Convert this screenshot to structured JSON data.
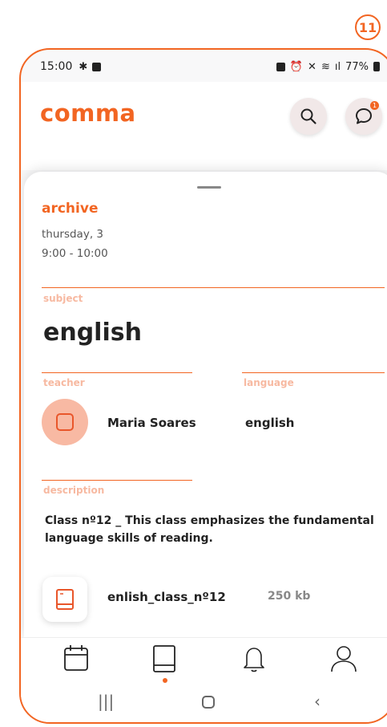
{
  "step_badge": "11",
  "status_bar": {
    "time": "15:00",
    "battery": "77%"
  },
  "app": {
    "logo": "comma",
    "accent_color": "#f26522",
    "label_color": "#f7b9a1"
  },
  "header_icons": [
    "search-icon",
    "chat-icon"
  ],
  "notification_count": "1",
  "detail": {
    "status": "archive",
    "date": "thursday, 3",
    "time_range": "9:00 - 10:00",
    "subject_label": "subject",
    "subject": "english",
    "teacher_label": "teacher",
    "teacher_name": "Maria Soares",
    "language_label": "language",
    "language": "english",
    "description_label": "description",
    "description": "Class nº12 _ This class emphasizes the fundamental language skills of reading.",
    "attachment": {
      "name": "enlish_class_nº12",
      "size": "250 kb"
    }
  },
  "bottom_nav": [
    {
      "icon": "calendar-icon",
      "active": false
    },
    {
      "icon": "book-icon",
      "active": true
    },
    {
      "icon": "bell-icon",
      "active": false
    },
    {
      "icon": "profile-icon",
      "active": false
    }
  ],
  "system_nav": [
    "recents-button",
    "home-button",
    "back-button"
  ]
}
